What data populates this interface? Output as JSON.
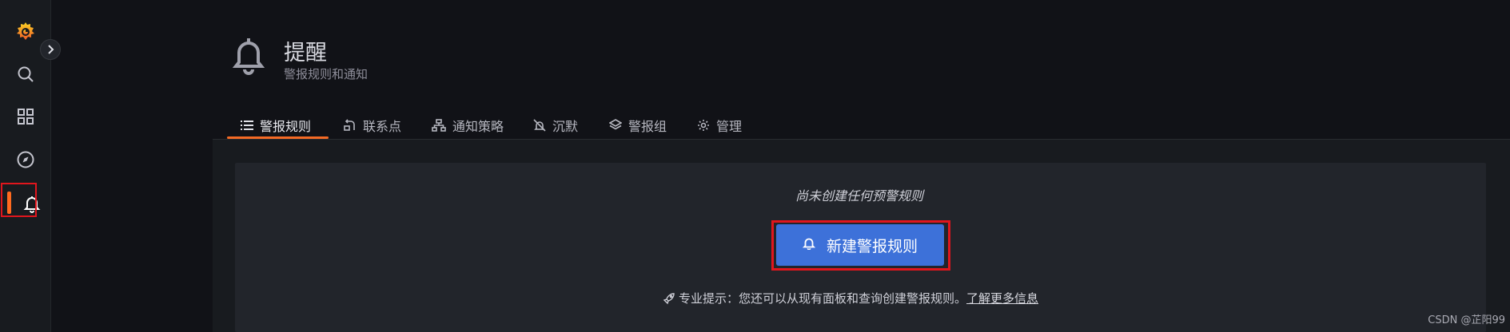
{
  "sidebar": {
    "items": [
      {
        "name": "grafana-logo",
        "icon": "grafana-logo-icon"
      },
      {
        "name": "search",
        "icon": "search-icon"
      },
      {
        "name": "dashboards",
        "icon": "grid-icon"
      },
      {
        "name": "explore",
        "icon": "compass-icon"
      },
      {
        "name": "alerting",
        "icon": "bell-icon",
        "active": true
      }
    ],
    "accent_color": "#ff6a1f"
  },
  "header": {
    "icon": "bell-icon",
    "title": "提醒",
    "subtitle": "警报规则和通知"
  },
  "tabs": [
    {
      "label": "警报规则",
      "icon": "list-icon",
      "active": true
    },
    {
      "label": "联系点",
      "icon": "contact-point-icon"
    },
    {
      "label": "通知策略",
      "icon": "sitemap-icon"
    },
    {
      "label": "沉默",
      "icon": "bell-slash-icon"
    },
    {
      "label": "警报组",
      "icon": "layers-icon"
    },
    {
      "label": "管理",
      "icon": "cog-icon"
    }
  ],
  "empty_state": {
    "message": "尚未创建任何预警规则",
    "button_label": "新建警报规则",
    "button_icon": "bell-icon",
    "tip_icon": "rocket-icon",
    "tip_text": "专业提示：您还可以从现有面板和查询创建警报规则。",
    "tip_link": "了解更多信息",
    "button_color": "#3d71d9"
  },
  "watermark": "CSDN @芷阳99"
}
